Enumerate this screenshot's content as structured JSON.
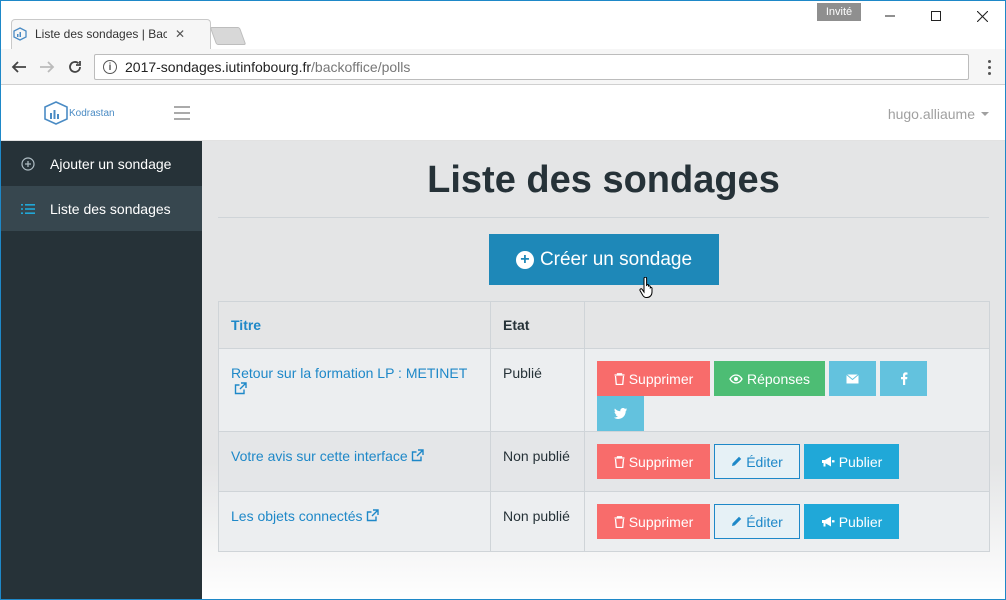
{
  "browser": {
    "tab_title": "Liste des sondages | Back",
    "invite_label": "Invité",
    "url_host": "2017-sondages.iutinfobourg.fr",
    "url_path": "/backoffice/polls"
  },
  "header": {
    "logo_text": "Kodrastan",
    "user": "hugo.alliaume"
  },
  "sidebar": {
    "items": [
      {
        "label": "Ajouter un sondage"
      },
      {
        "label": "Liste des sondages"
      }
    ]
  },
  "main": {
    "title": "Liste des sondages",
    "create_label": "Créer un sondage",
    "table": {
      "columns": [
        "Titre",
        "Etat",
        ""
      ],
      "rows": [
        {
          "title": "Retour sur la formation LP : METINET",
          "state": "Publié"
        },
        {
          "title": "Votre avis sur cette interface",
          "state": "Non publié"
        },
        {
          "title": "Les objets connectés",
          "state": "Non publié"
        }
      ]
    },
    "actions": {
      "delete": "Supprimer",
      "responses": "Réponses",
      "edit": "Éditer",
      "publish": "Publier"
    }
  },
  "colors": {
    "primary": "#1e88b8",
    "danger": "#f86c6b",
    "success": "#4dbd74",
    "info": "#63c2de",
    "sidebar": "#263238"
  }
}
